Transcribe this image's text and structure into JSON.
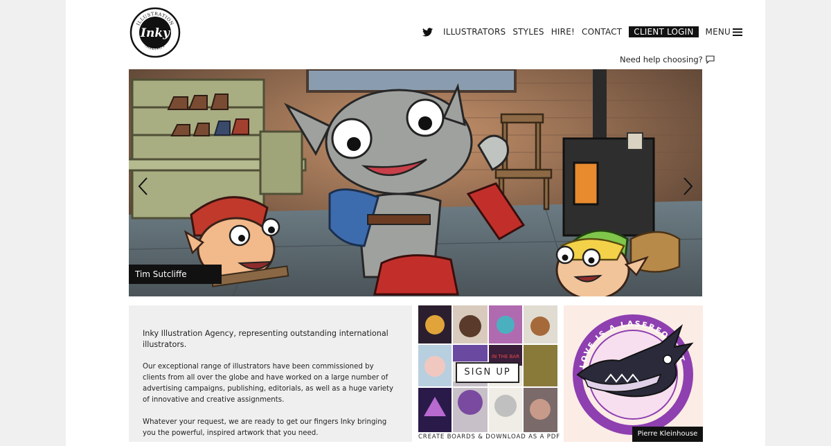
{
  "brand": {
    "logo_arc_top": "ILLUSTRATION",
    "logo_word": "Inky",
    "logo_arc_bottom": "AGENCY"
  },
  "nav": {
    "twitter_icon": "twitter-bird-icon",
    "items": [
      "ILLUSTRATORS",
      "STYLES",
      "HIRE!",
      "CONTACT"
    ],
    "login_label": "CLIENT LOGIN",
    "menu_label": "MENU"
  },
  "help": {
    "label": "Need help choosing?",
    "icon": "speech-bubble-icon"
  },
  "hero": {
    "caption": "Tim Sutcliffe",
    "prev_icon": "chevron-left-icon",
    "next_icon": "chevron-right-icon"
  },
  "about": {
    "lead": "Inky Illustration Agency, representing outstanding international illustrators.",
    "para1": "Our exceptional range of illustrators have been commissioned by clients from all over the globe and have worked on a large number of advertising campaigns, publishing, editorials, as well as a huge variety of innovative and creative assignments.",
    "para2": "Whatever your request, we are ready to get our fingers Inky bringing you the powerful, inspired artwork that you need."
  },
  "boards": {
    "signup_label": "SIGN UP",
    "subtitle": "CREATE BOARDS & DOWNLOAD AS A PDF"
  },
  "feature": {
    "caption": "Pierre Kleinhouse",
    "badge_text": "LOVE IS A LASEREQUEST"
  },
  "colors": {
    "caption_bg": "#111111",
    "about_bg": "#efefef",
    "feature_bg": "#fbece6",
    "badge_purple": "#8e3fb0"
  }
}
